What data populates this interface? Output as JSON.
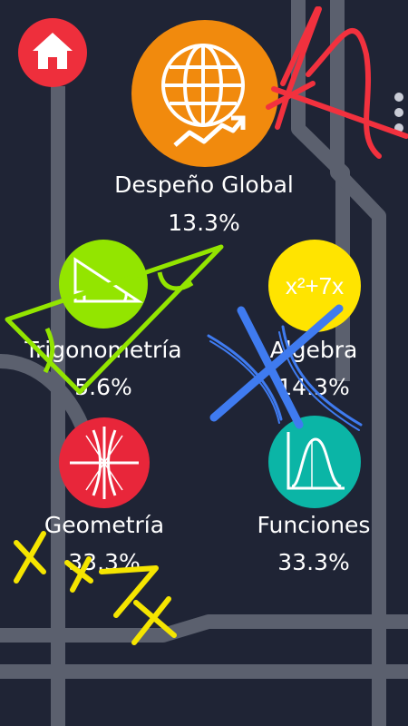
{
  "home": {
    "icon": "home-icon"
  },
  "menu": {
    "icon": "more-vert-icon"
  },
  "global": {
    "title": "Despeño Global",
    "percent": "13.3%",
    "icon": "globe-growth-icon",
    "color": "#f18a0d"
  },
  "topics": [
    {
      "name": "Trigonometría",
      "percent": "5.6%",
      "icon": "right-triangle-icon",
      "color": "#93e500"
    },
    {
      "name": "Algebra",
      "percent": "14.3%",
      "icon": "algebra-expression-icon",
      "color": "#ffe400",
      "icon_text": "x²+7x"
    },
    {
      "name": "Geometría",
      "percent": "33.3%",
      "icon": "hyperbola-icon",
      "color": "#e8263a"
    },
    {
      "name": "Funciones",
      "percent": "33.3%",
      "icon": "function-graph-icon",
      "color": "#0bb5a6"
    }
  ],
  "decorations": {
    "yellow_scribble_text": "x+7x"
  }
}
